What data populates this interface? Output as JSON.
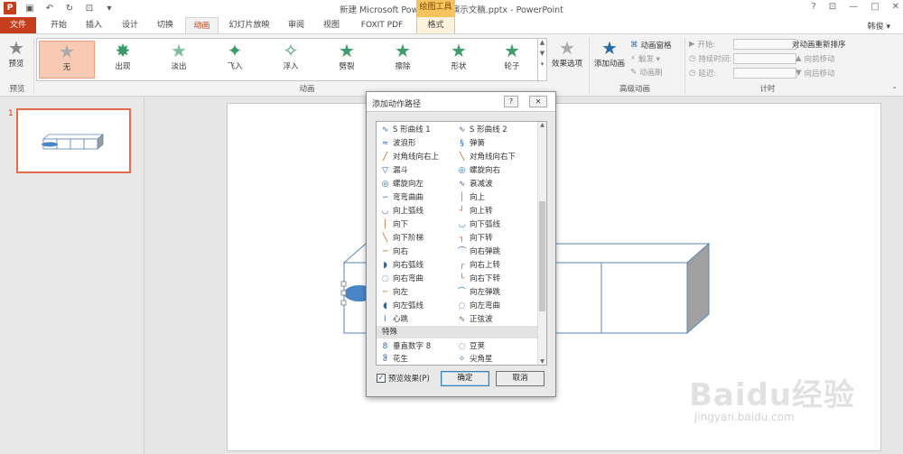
{
  "title_bar": {
    "document_title": "新建 Microsoft PowerPoint 演示文稿.pptx - PowerPoint",
    "context_tool_title": "绘图工具",
    "help": "?",
    "restore_ribbon": "⊡",
    "minimize": "—",
    "maximize": "□",
    "close": "✕"
  },
  "tabs": [
    "文件",
    "开始",
    "插入",
    "设计",
    "切换",
    "动画",
    "幻灯片放映",
    "审阅",
    "视图",
    "FOXIT PDF",
    "格式"
  ],
  "active_tab": "动画",
  "user": "韩俊 ▾",
  "ribbon": {
    "preview": {
      "button": "预览",
      "group": "预览"
    },
    "animation_gallery": [
      "无",
      "出现",
      "淡出",
      "飞入",
      "浮入",
      "劈裂",
      "擦除",
      "形状",
      "轮子"
    ],
    "selected_effect": "无",
    "effect_options": "效果选项",
    "animation_group": "动画",
    "add_animation": "添加动画",
    "animation_pane": "动画窗格",
    "trigger": "触发 ▾",
    "animation_painter": "动画刷",
    "advanced_group": "高级动画",
    "start_label": "开始:",
    "duration_label": "持续时间:",
    "delay_label": "延迟:",
    "timing_group": "计时",
    "reorder_title": "对动画重新排序",
    "move_earlier": "向前移动",
    "move_later": "向后移动"
  },
  "slides_panel": {
    "slide_number": "1"
  },
  "dialog": {
    "title": "添加动作路径",
    "help_btn": "?",
    "close_btn": "✕",
    "rows": [
      [
        "S 形曲线 1",
        "S 形曲线 2"
      ],
      [
        "波浪形",
        "弹簧"
      ],
      [
        "对角线向右上",
        "对角线向右下"
      ],
      [
        "漏斗",
        "螺旋向右"
      ],
      [
        "螺旋向左",
        "衰减波"
      ],
      [
        "弯弯曲曲",
        "向上"
      ],
      [
        "向上弧线",
        "向上转"
      ],
      [
        "向下",
        "向下弧线"
      ],
      [
        "向下阶梯",
        "向下转"
      ],
      [
        "向右",
        "向右弹跳"
      ],
      [
        "向右弧线",
        "向右上转"
      ],
      [
        "向右弯曲",
        "向右下转"
      ],
      [
        "向左",
        "向左弹跳"
      ],
      [
        "向左弧线",
        "向左弯曲"
      ],
      [
        "心跳",
        "正弦波"
      ]
    ],
    "section_special": "特殊",
    "special_rows": [
      [
        "垂直数字 8",
        "豆荚"
      ],
      [
        "花生",
        "尖角星"
      ]
    ],
    "preview_checkbox": "预览效果(P)",
    "ok": "确定",
    "cancel": "取消"
  },
  "watermark": {
    "brand": "Baidu经验",
    "url": "jingyan.baidu.com"
  },
  "colors": {
    "accent": "#c43e1c",
    "star_green": "#3d9b6c",
    "shape_stroke": "#5b86b6",
    "ellipse_fill": "#4a86c5"
  }
}
